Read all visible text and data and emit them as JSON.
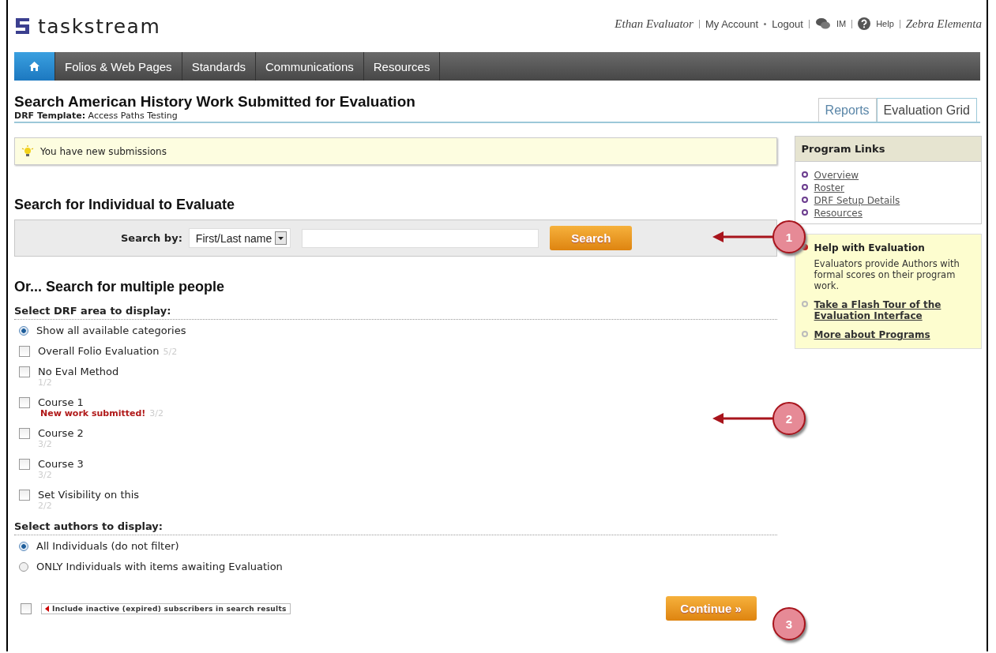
{
  "header": {
    "logo": "taskstream",
    "user": "Ethan Evaluator",
    "links": [
      {
        "label": "My Account",
        "kind": "link"
      },
      {
        "label": "Logout",
        "kind": "link"
      },
      {
        "label": "IM",
        "kind": "chat"
      },
      {
        "label": "Help",
        "kind": "help"
      }
    ],
    "organization": "Zebra Elementa"
  },
  "nav": [
    {
      "kind": "home",
      "selected": true
    },
    {
      "label": "Folios & Web Pages",
      "kind": "tab",
      "selected": false
    },
    {
      "label": "Standards",
      "kind": "tab",
      "selected": false
    },
    {
      "label": "Communications",
      "kind": "tab",
      "selected": false
    },
    {
      "label": "Resources",
      "kind": "tab",
      "selected": false
    }
  ],
  "page": {
    "title": "Search American History Work Submitted for Evaluation",
    "subtitle_label": "DRF Template:",
    "subtitle": "Access Paths Testing"
  },
  "view_tabs": [
    {
      "label": "Reports",
      "selected": false
    },
    {
      "label": "Evaluation Grid",
      "selected": true
    }
  ],
  "notice": "You have new submissions",
  "individual_search": {
    "heading": "Search for Individual to Evaluate",
    "label": "Search by:",
    "select_value": "First/Last name",
    "button": "Search"
  },
  "multiple_search": {
    "heading": "Or... Search for multiple people",
    "area_heading": "Select DRF area to display:",
    "areas": [
      {
        "kind": "radio",
        "label": "Show all available categories",
        "checked": true
      },
      {
        "kind": "inline-count",
        "label": "Overall Folio Evaluation",
        "count": "5/2",
        "checked": false
      },
      {
        "kind": "stacked-count",
        "label": "No Eval Method",
        "count": "1/2",
        "checked": false
      },
      {
        "kind": "stacked-count",
        "label": "Course 1",
        "note": "New work submitted!",
        "count": "3/2",
        "checked": false
      },
      {
        "kind": "stacked-count",
        "label": "Course 2",
        "count": "3/2",
        "checked": false
      },
      {
        "kind": "stacked-count",
        "label": "Course 3",
        "count": "3/2",
        "checked": false
      },
      {
        "kind": "stacked-count",
        "label": "Set Visibility on this",
        "count": "2/2",
        "checked": false
      }
    ],
    "authors_heading": "Select authors to display:",
    "authors": [
      {
        "label": "All Individuals (do not filter)",
        "selected": true
      },
      {
        "label": "ONLY Individuals with items awaiting Evaluation",
        "selected": false
      }
    ],
    "include_inactive": {
      "label": "Include inactive (expired) subscribers in search results",
      "checked": false
    },
    "button": "Continue »"
  },
  "sidebar": {
    "links_title": "Program Links",
    "links": [
      "Overview",
      "Roster",
      "DRF Setup Details",
      "Resources"
    ],
    "help_title": "Help with Evaluation",
    "help_text": "Evaluators provide Authors with formal scores on their program work.",
    "help_links": [
      "Take a Flash Tour of the Evaluation Interface",
      "More about Programs"
    ]
  },
  "callouts": [
    {
      "number": "1",
      "arrow": true
    },
    {
      "number": "2",
      "arrow": true
    },
    {
      "number": "3",
      "arrow": false
    }
  ]
}
